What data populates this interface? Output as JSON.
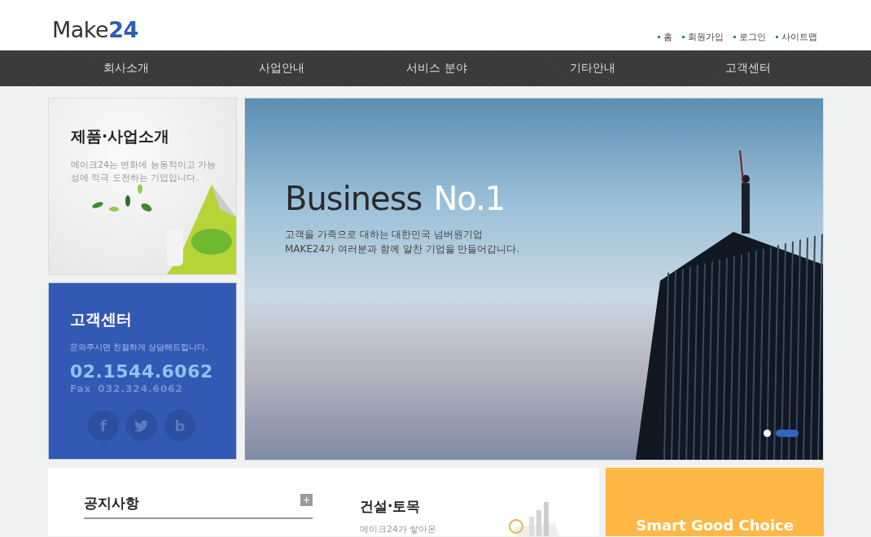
{
  "header": {
    "logo": {
      "text": "Make",
      "accent": "24"
    },
    "links": [
      "홈",
      "회원가입",
      "로그인",
      "사이트맵"
    ]
  },
  "nav": [
    "회사소개",
    "사업안내",
    "서비스 분야",
    "기타안내",
    "고객센터"
  ],
  "promo": {
    "title": "제품·사업소개",
    "text": "메이크24는 변화에 능동적이고 가능성에 적극 도전하는 기업입니다."
  },
  "contact": {
    "title": "고객센터",
    "text": "문의주시면 친절하게 상담해드립니다.",
    "phone": "02.1544.6062",
    "fax_label": "Fax",
    "fax": "032.324.6062",
    "social": [
      {
        "kind": "letter",
        "glyph": "f"
      },
      {
        "kind": "bird"
      },
      {
        "kind": "letter",
        "glyph": "b"
      }
    ]
  },
  "hero": {
    "headline": "Business",
    "headline_accent": "No.1",
    "lines": [
      "고객을 가족으로 대하는 대한민국 넘버원기업",
      "MAKE24가 여러분과 함께 알찬 기업을 만들어갑니다."
    ],
    "slides": [
      {
        "selected": false
      },
      {
        "selected": true
      }
    ]
  },
  "notice": {
    "title": "공지사항",
    "more": "+"
  },
  "business": {
    "title": "건설·토목",
    "text": "메이크24가 쌓아온"
  },
  "slogan": "Smart Good Choice"
}
